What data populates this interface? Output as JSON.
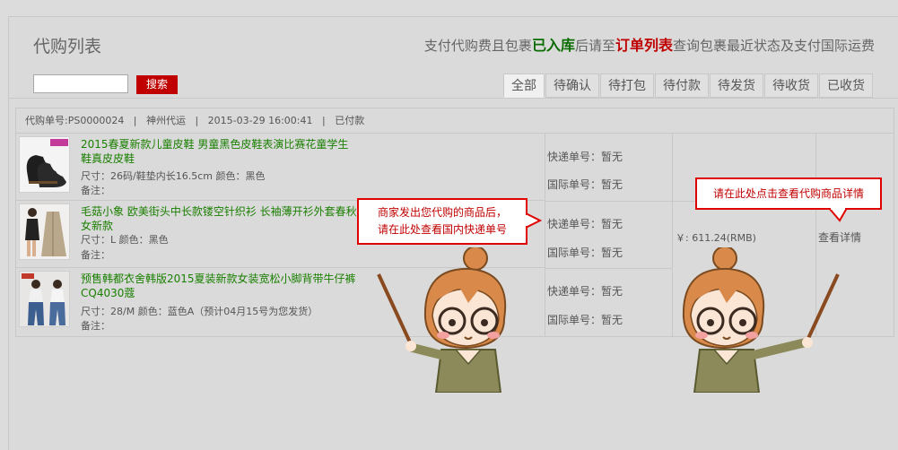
{
  "page": {
    "title": "代购列表",
    "notice_pre": "支付代购费且包裹",
    "notice_green": "已入库",
    "notice_mid": "后请至",
    "notice_red": "订单列表",
    "notice_post": "查询包裹最近状态及支付国际运费"
  },
  "search": {
    "button_label": "搜索",
    "value": ""
  },
  "tabs": [
    "全部",
    "待确认",
    "待打包",
    "待付款",
    "待发货",
    "待收货",
    "已收货"
  ],
  "order": {
    "header": "代购单号:PS0000024   |   神州代运   |   2015-03-29 16:00:41   |   已付款",
    "items": [
      {
        "name": "2015春夏新款儿童皮鞋 男童黑色皮鞋表演比赛花童学生鞋真皮皮鞋",
        "attrs": "尺寸：26码/鞋垫内长16.5cm    颜色：黑色",
        "note": "备注：",
        "domestic": "快递单号：暂无",
        "international": "国际单号：暂无"
      },
      {
        "name": "毛菇小象 欧美街头中长款镂空针织衫 长袖薄开衫外套春秋女新款",
        "attrs": "尺寸：L    颜色：黑色",
        "note": "备注：",
        "domestic": "快递单号：暂无",
        "international": "国际单号：暂无"
      },
      {
        "name": "预售韩都衣舍韩版2015夏装新款女装宽松小脚背带牛仔裤CQ4030蔻",
        "attrs": "尺寸：28/M    颜色：蓝色A（预计04月15号为您发货）",
        "note": "备注：",
        "domestic": "快递单号：暂无",
        "international": "国际单号：暂无"
      }
    ],
    "price": "￥: 611.24(RMB)",
    "details_link": "查看详情"
  },
  "tips": {
    "shipping_tip_line1": "商家发出您代购的商品后，",
    "shipping_tip_line2": "请在此处查看国内快递单号",
    "details_tip": "请在此处点击查看代购商品详情"
  },
  "colors": {
    "accent_red": "#c00000",
    "link_green": "#1a7f00",
    "status_green": "#0a6b00"
  },
  "icons": [
    "shoe-thumbnail",
    "cardigan-thumbnail",
    "jeans-thumbnail",
    "girl-pointer-illustration"
  ]
}
